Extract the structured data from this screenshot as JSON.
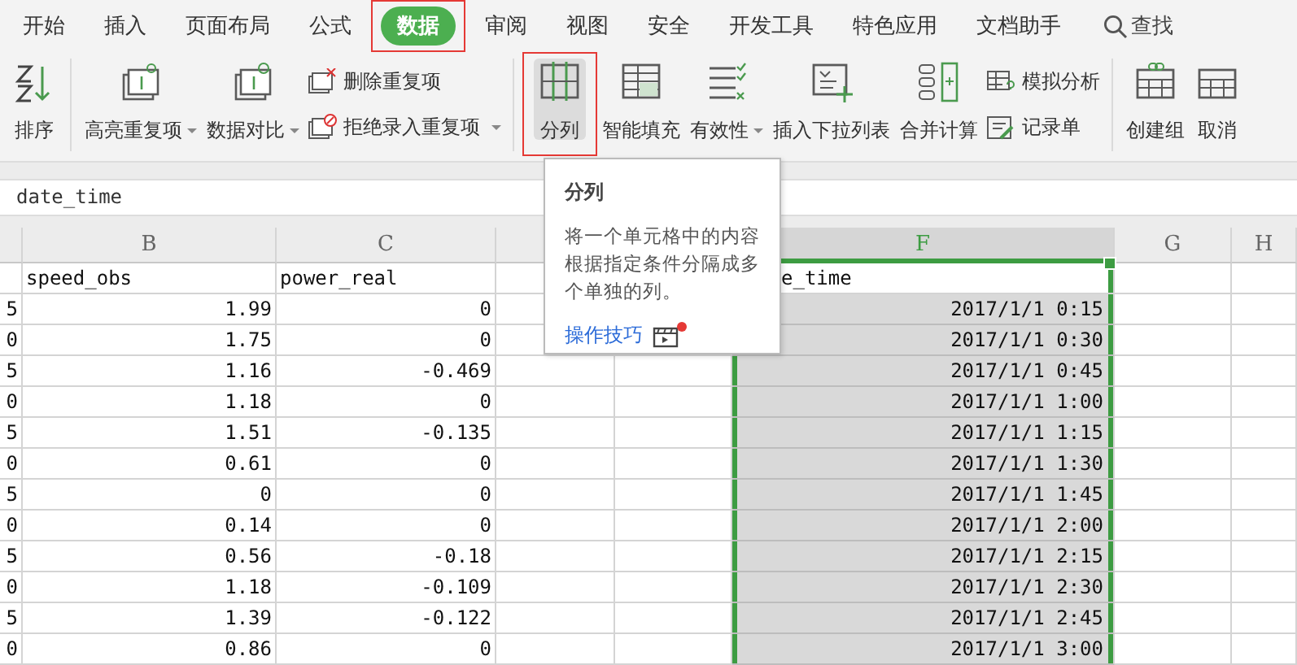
{
  "menu_tabs": [
    {
      "label": "开始",
      "selected": false,
      "highlighted": false
    },
    {
      "label": "插入",
      "selected": false,
      "highlighted": false
    },
    {
      "label": "页面布局",
      "selected": false,
      "highlighted": false
    },
    {
      "label": "公式",
      "selected": false,
      "highlighted": false
    },
    {
      "label": "数据",
      "selected": true,
      "highlighted": true
    },
    {
      "label": "审阅",
      "selected": false,
      "highlighted": false
    },
    {
      "label": "视图",
      "selected": false,
      "highlighted": false
    },
    {
      "label": "安全",
      "selected": false,
      "highlighted": false
    },
    {
      "label": "开发工具",
      "selected": false,
      "highlighted": false
    },
    {
      "label": "特色应用",
      "selected": false,
      "highlighted": false
    },
    {
      "label": "文档助手",
      "selected": false,
      "highlighted": false
    }
  ],
  "search": {
    "label": "查找"
  },
  "ribbon": [
    {
      "kind": "large",
      "label": "排序",
      "dropdown": false,
      "pressed": false,
      "highlighted": false
    },
    {
      "kind": "separator"
    },
    {
      "kind": "large",
      "label": "高亮重复项",
      "dropdown": true,
      "pressed": false,
      "highlighted": false
    },
    {
      "kind": "large",
      "label": "数据对比",
      "dropdown": true,
      "pressed": false,
      "highlighted": false
    },
    {
      "kind": "stack",
      "items": [
        {
          "label": "删除重复项",
          "dropdown": false
        },
        {
          "label": "拒绝录入重复项",
          "dropdown": true
        }
      ]
    },
    {
      "kind": "separator"
    },
    {
      "kind": "large",
      "label": "分列",
      "dropdown": false,
      "pressed": true,
      "highlighted": true
    },
    {
      "kind": "large",
      "label": "智能填充",
      "dropdown": false,
      "pressed": false,
      "highlighted": false
    },
    {
      "kind": "large",
      "label": "有效性",
      "dropdown": true,
      "pressed": false,
      "highlighted": false
    },
    {
      "kind": "large",
      "label": "插入下拉列表",
      "dropdown": false,
      "pressed": false,
      "highlighted": false
    },
    {
      "kind": "large",
      "label": "合并计算",
      "dropdown": false,
      "pressed": false,
      "highlighted": false
    },
    {
      "kind": "stack",
      "items": [
        {
          "label": "模拟分析",
          "dropdown": false
        },
        {
          "label": "记录单",
          "dropdown": false
        }
      ]
    },
    {
      "kind": "separator"
    },
    {
      "kind": "large",
      "label": "创建组",
      "dropdown": false,
      "pressed": false,
      "highlighted": false
    },
    {
      "kind": "large",
      "label": "取消",
      "dropdown": false,
      "pressed": false,
      "highlighted": false
    }
  ],
  "formula_bar": {
    "value": "date_time"
  },
  "tooltip": {
    "title": "分列",
    "text": "将一个单元格中的内容根据指定条件分隔成多个单独的列。",
    "link": "操作技巧",
    "new_badge": true
  },
  "columns": [
    {
      "selected": false
    },
    {
      "label": "B",
      "selected": false
    },
    {
      "label": "C",
      "selected": false
    },
    null,
    null,
    {
      "label": "F",
      "selected": true
    },
    {
      "label": "G",
      "selected": false
    },
    {
      "label": "H",
      "selected": false
    }
  ],
  "rows": [
    {
      "active": true,
      "cells": [
        null,
        "speed_obs",
        "power_real",
        null,
        null,
        "e_time",
        null,
        null
      ]
    },
    {
      "active": false,
      "cells": [
        "5",
        "1.99",
        "0",
        null,
        null,
        "2017/1/1 0:15",
        null,
        null
      ]
    },
    {
      "active": false,
      "cells": [
        "0",
        "1.75",
        "0",
        null,
        null,
        "2017/1/1 0:30",
        null,
        null
      ]
    },
    {
      "active": false,
      "cells": [
        "5",
        "1.16",
        "-0.469",
        null,
        null,
        "2017/1/1 0:45",
        null,
        null
      ]
    },
    {
      "active": false,
      "cells": [
        "0",
        "1.18",
        "0",
        null,
        null,
        "2017/1/1 1:00",
        null,
        null
      ]
    },
    {
      "active": false,
      "cells": [
        "5",
        "1.51",
        "-0.135",
        null,
        null,
        "2017/1/1 1:15",
        null,
        null
      ]
    },
    {
      "active": false,
      "cells": [
        "0",
        "0.61",
        "0",
        null,
        null,
        "2017/1/1 1:30",
        null,
        null
      ]
    },
    {
      "active": false,
      "cells": [
        "5",
        "0",
        "0",
        null,
        null,
        "2017/1/1 1:45",
        null,
        null
      ]
    },
    {
      "active": false,
      "cells": [
        "0",
        "0.14",
        "0",
        null,
        null,
        "2017/1/1 2:00",
        null,
        null
      ]
    },
    {
      "active": false,
      "cells": [
        "5",
        "0.56",
        "-0.18",
        null,
        null,
        "2017/1/1 2:15",
        null,
        null
      ]
    },
    {
      "active": false,
      "cells": [
        "0",
        "1.18",
        "-0.109",
        null,
        null,
        "2017/1/1 2:30",
        null,
        null
      ]
    },
    {
      "active": false,
      "cells": [
        "5",
        "1.39",
        "-0.122",
        null,
        null,
        "2017/1/1 2:45",
        null,
        null
      ]
    },
    {
      "active": false,
      "cells": [
        "0",
        "0.86",
        "0",
        null,
        null,
        "2017/1/1 3:00",
        null,
        null
      ]
    }
  ]
}
